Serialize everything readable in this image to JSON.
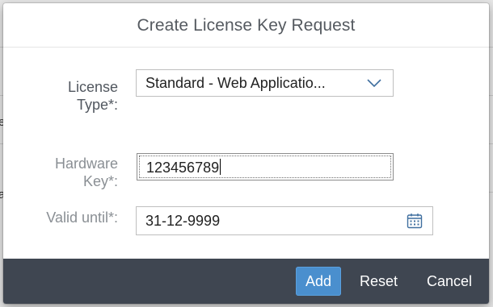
{
  "background": {
    "edge_glyphs_left": [
      "e",
      "a"
    ],
    "edge_glyphs_right": [
      "a",
      "a"
    ]
  },
  "dialog": {
    "title": "Create License Key Request",
    "fields": {
      "license_type": {
        "label_line1": "License",
        "label_line2": "Type*:",
        "value": "Standard - Web Applicatio..."
      },
      "hardware_key": {
        "label_line1": "Hardware",
        "label_line2": "Key*:",
        "value": "123456789"
      },
      "valid_until": {
        "label": "Valid until*:",
        "value": "31-12-9999"
      }
    },
    "footer": {
      "add_label": "Add",
      "reset_label": "Reset",
      "cancel_label": "Cancel"
    }
  },
  "icons": {
    "dropdown": "chevron-down-icon",
    "date_picker": "calendar-icon"
  },
  "colors": {
    "accent": "#4a8fce",
    "footer_bg": "#3f4651",
    "title_text": "#555a60"
  }
}
